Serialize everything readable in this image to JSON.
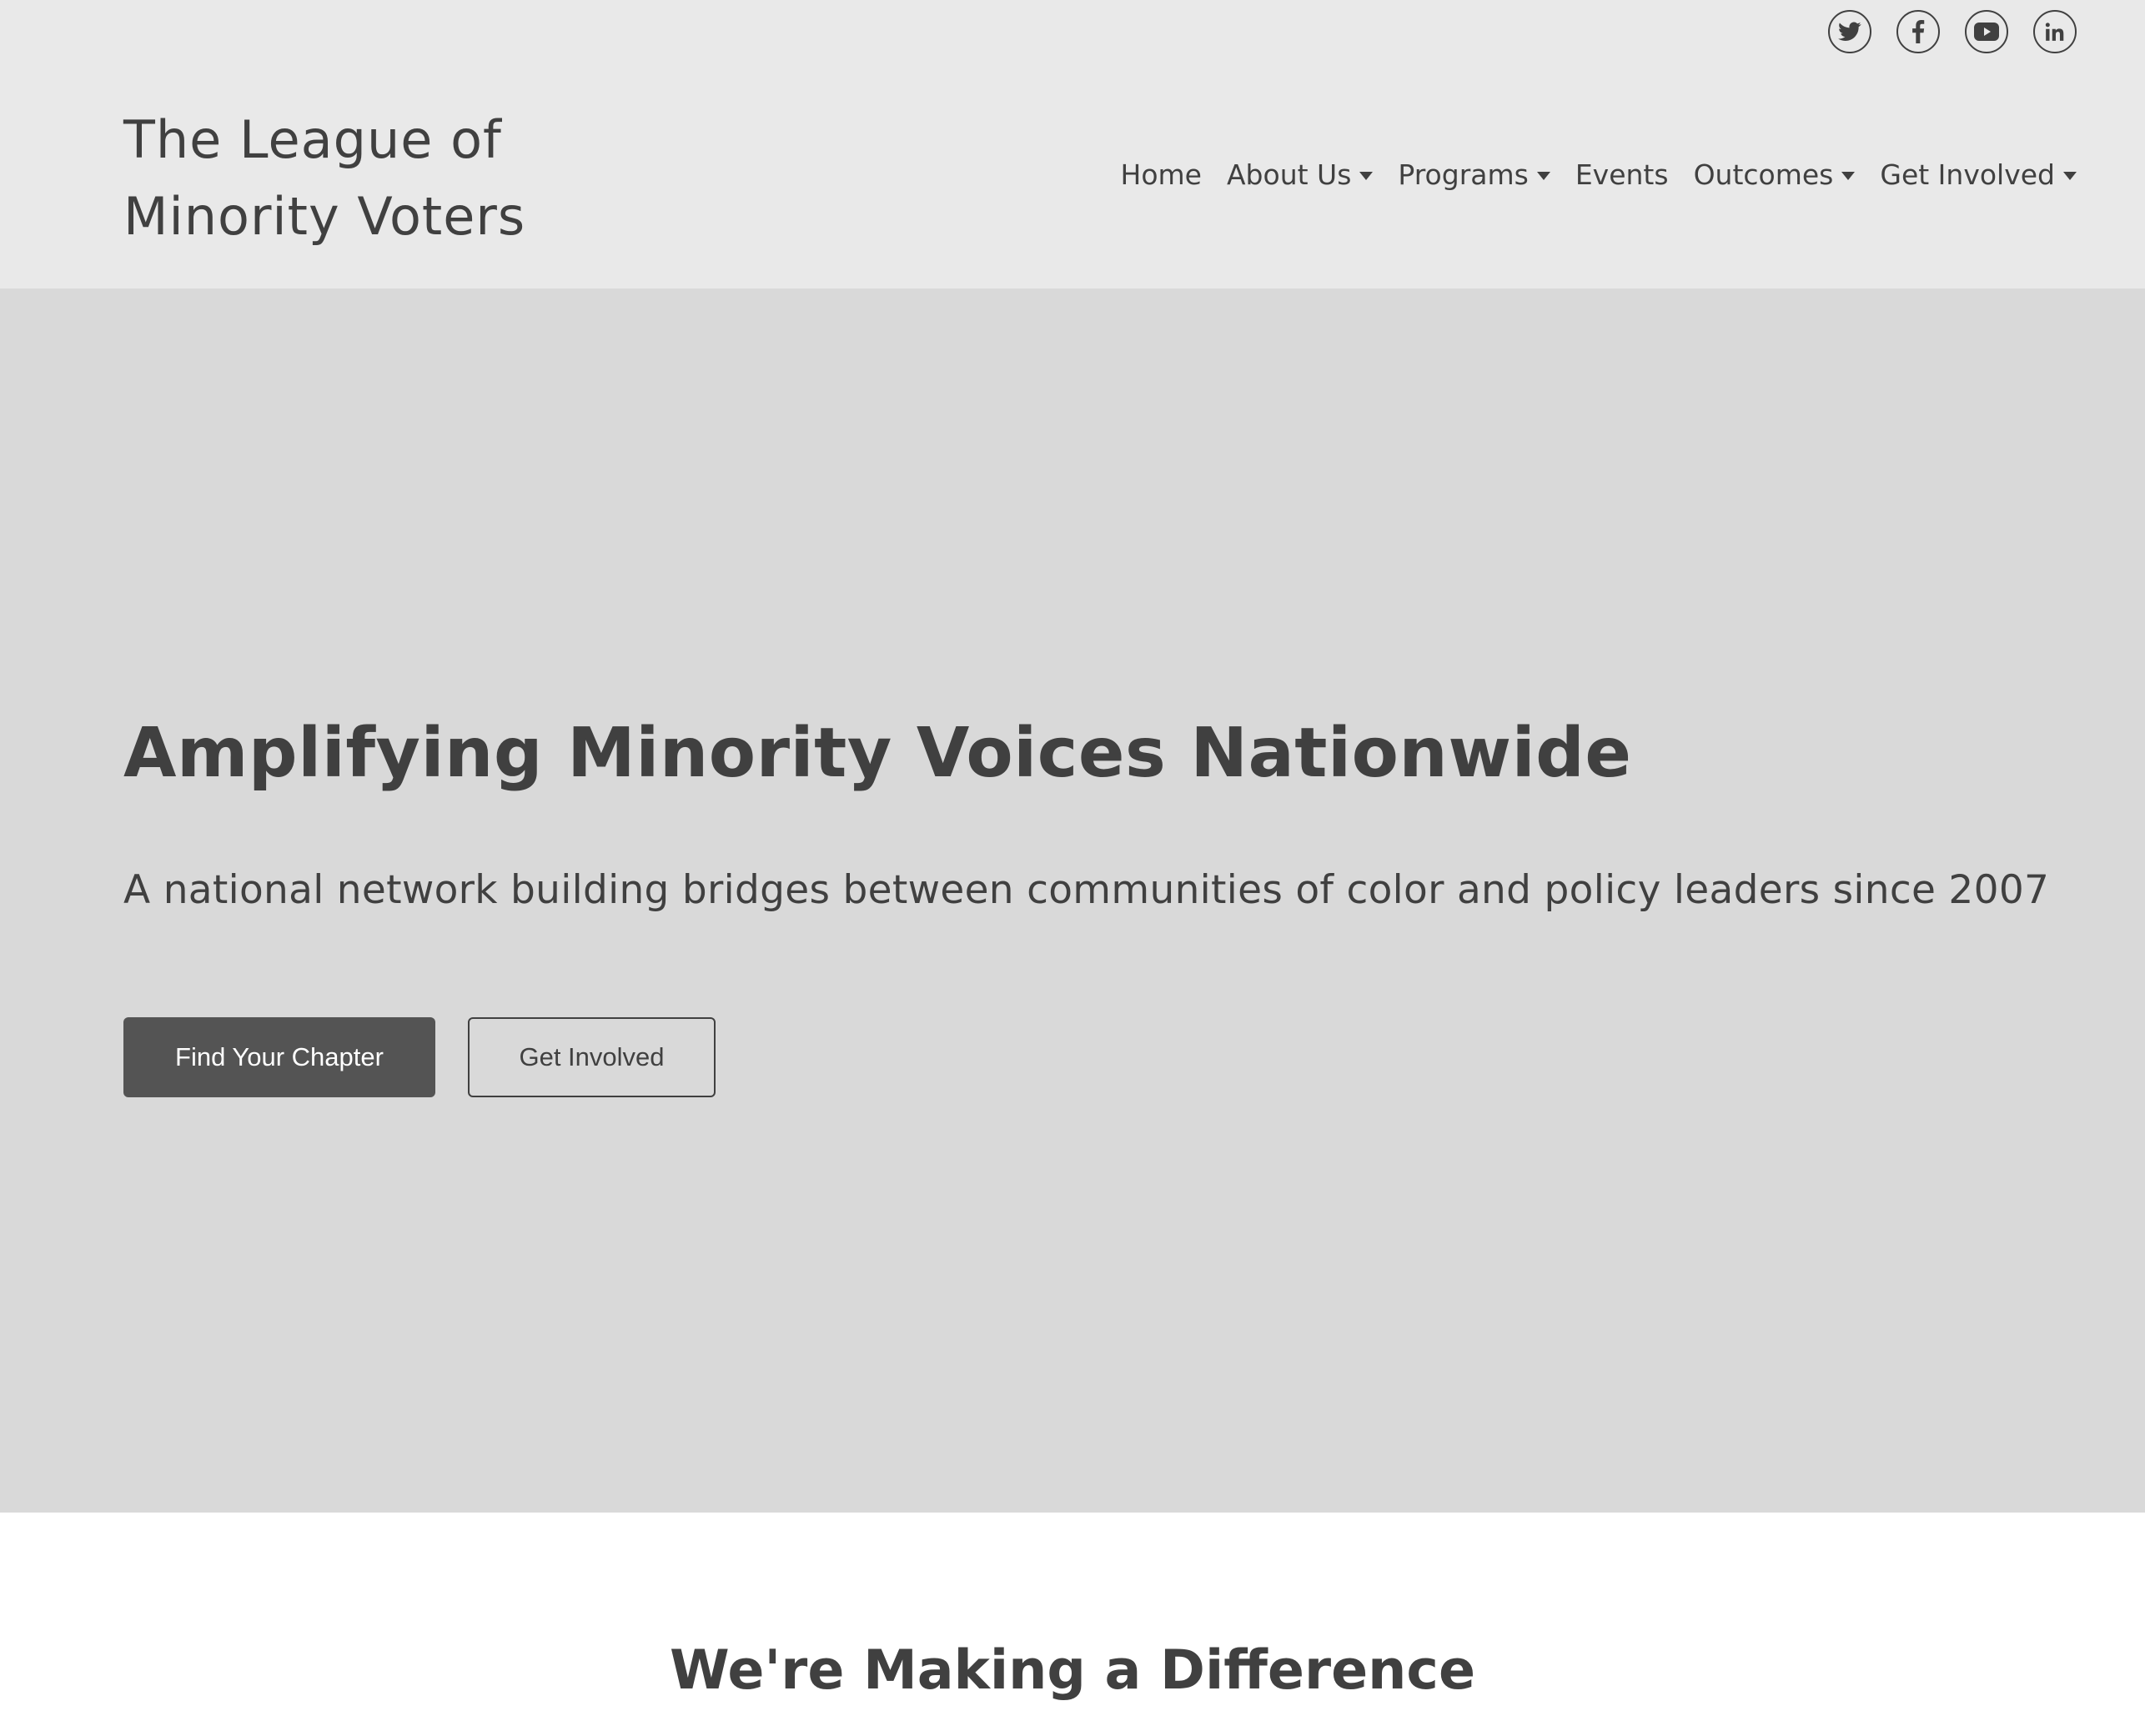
{
  "social": {
    "icons": [
      "twitter-icon",
      "facebook-icon",
      "youtube-icon",
      "linkedin-icon"
    ]
  },
  "brand": {
    "line1": "The League of",
    "line2": "Minority Voters"
  },
  "nav": {
    "home": "Home",
    "about": "About Us",
    "programs": "Programs",
    "events": "Events",
    "outcomes": "Outcomes",
    "get_involved": "Get Involved"
  },
  "hero": {
    "title": "Amplifying Minority Voices Nationwide",
    "subtitle": "A national network building bridges between communities of color and policy leaders since 2007",
    "primary_button": "Find Your Chapter",
    "secondary_button": "Get Involved"
  },
  "section": {
    "title": "We're Making a Difference"
  },
  "colors": {
    "header_bg": "#e9e9e9",
    "hero_bg": "#d9d9d9",
    "text": "#404040",
    "primary_button_bg": "#545454"
  }
}
